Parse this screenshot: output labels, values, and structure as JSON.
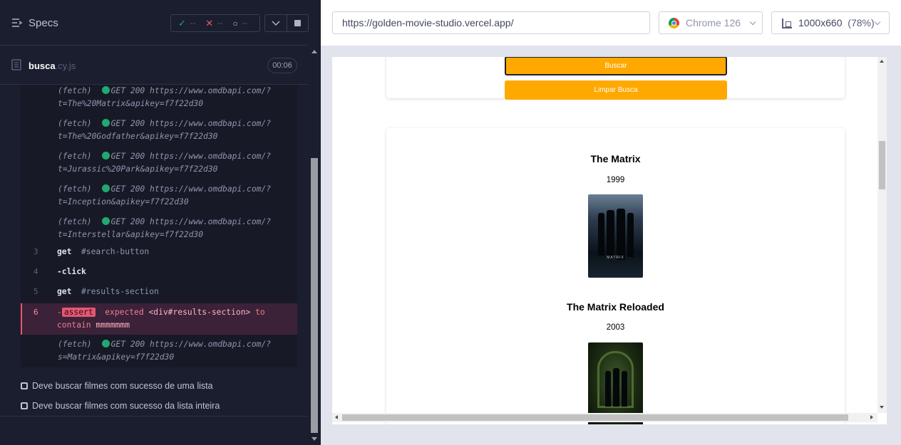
{
  "sidebar": {
    "title": "Specs",
    "stats": {
      "passed": "--",
      "failed": "--",
      "pending": "--"
    },
    "file": {
      "name": "busca",
      "ext": ".cy.js",
      "duration": "00:06"
    },
    "fetches": [
      {
        "label": "(fetch)",
        "method": "GET 200",
        "url_line1": "https://www.omdbapi.com/?",
        "url_line2": "t=The%20Matrix&apikey=f7f22d30"
      },
      {
        "label": "(fetch)",
        "method": "GET 200",
        "url_line1": "https://www.omdbapi.com/?",
        "url_line2": "t=The%20Godfather&apikey=f7f22d30"
      },
      {
        "label": "(fetch)",
        "method": "GET 200",
        "url_line1": "https://www.omdbapi.com/?",
        "url_line2": "t=Jurassic%20Park&apikey=f7f22d30"
      },
      {
        "label": "(fetch)",
        "method": "GET 200",
        "url_line1": "https://www.omdbapi.com/?",
        "url_line2": "t=Inception&apikey=f7f22d30"
      },
      {
        "label": "(fetch)",
        "method": "GET 200",
        "url_line1": "https://www.omdbapi.com/?",
        "url_line2": "t=Interstellar&apikey=f7f22d30"
      }
    ],
    "commands": [
      {
        "num": "3",
        "name": "get",
        "arg": "#search-button"
      },
      {
        "num": "4",
        "name": "-click",
        "arg": ""
      },
      {
        "num": "5",
        "name": "get",
        "arg": "#results-section"
      }
    ],
    "assert": {
      "num": "6",
      "prefix": "-",
      "badge": "assert",
      "word1": "expected",
      "selector": "<div#results-section>",
      "word2": "to",
      "word3": "contain",
      "value": "mmmmmmm"
    },
    "last_fetch": {
      "label": "(fetch)",
      "method": "GET 200",
      "url_line1": "https://www.omdbapi.com/?",
      "url_line2": "s=Matrix&apikey=f7f22d30"
    },
    "tests": [
      "Deve buscar filmes com sucesso de uma lista",
      "Deve buscar filmes com sucesso da lista inteira"
    ]
  },
  "browser_bar": {
    "url": "https://golden-movie-studio.vercel.app/",
    "browser": "Chrome 126",
    "viewport": "1000x660",
    "scale": "(78%)"
  },
  "app": {
    "search_button": "Buscar",
    "clear_button": "Limpar Busca",
    "movies": [
      {
        "title": "The Matrix",
        "year": "1999",
        "poster_text": "MATRIX"
      },
      {
        "title": "The Matrix Reloaded",
        "year": "2003"
      }
    ]
  },
  "colors": {
    "accent": "#ffa800",
    "pass": "#1fa971",
    "fail": "#e45770"
  }
}
